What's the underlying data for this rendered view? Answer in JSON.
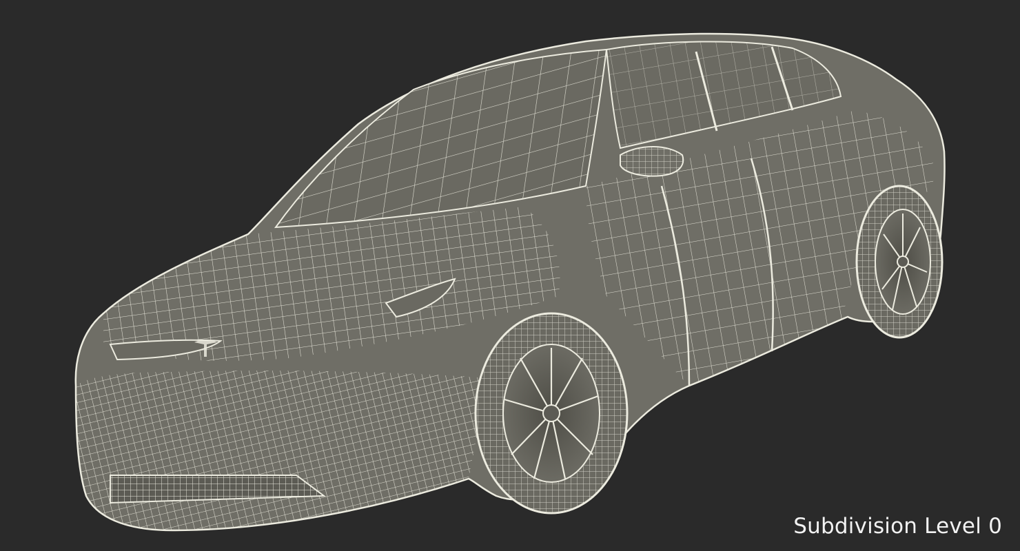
{
  "caption": "Subdivision Level 0",
  "colors": {
    "background": "#2a2a2a",
    "body": "#6f6e66",
    "wire": "#ecebdf",
    "caption": "#f2f2f2"
  }
}
